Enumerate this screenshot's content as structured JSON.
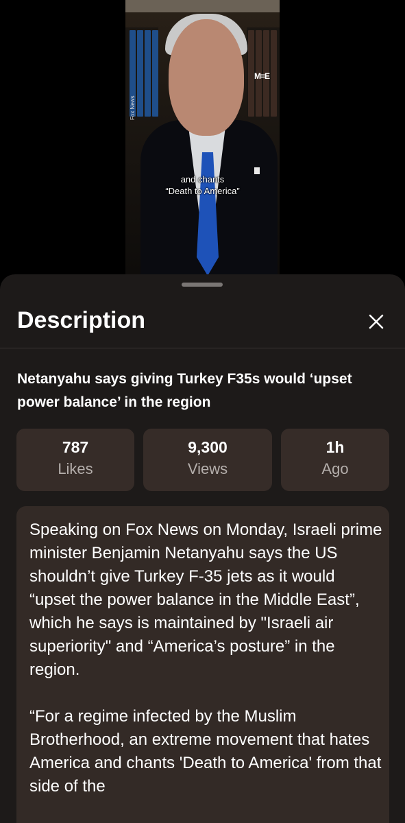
{
  "video": {
    "watermark": "M=E",
    "credit": "Fox News",
    "caption_line1": "and chants",
    "caption_line2": "“Death to America”"
  },
  "sheet": {
    "title": "Description",
    "close_icon": "close-icon",
    "headline": "Netanyahu says giving Turkey F35s would ‘upset power balance’ in the region",
    "stats": [
      {
        "value": "787",
        "label": "Likes"
      },
      {
        "value": "9,300",
        "label": "Views"
      },
      {
        "value": "1h",
        "label": "Ago"
      }
    ],
    "description": {
      "paragraph1": "Speaking on Fox News on Monday, Israeli prime minister Benjamin Netanyahu says the US shouldn’t give Turkey F-35 jets as it would “upset the power balance in the Middle East”, which he says is maintained by \"Israeli air superiority\" and “America’s posture” in the region.",
      "paragraph2": "“For a regime infected by the Muslim Brotherhood, an extreme movement that hates America and chants 'Death to America' from that side of the"
    }
  },
  "colors": {
    "sheet_bg": "#1d1a19",
    "card_bg": "#362c28",
    "muted_text": "#b4aeab"
  }
}
